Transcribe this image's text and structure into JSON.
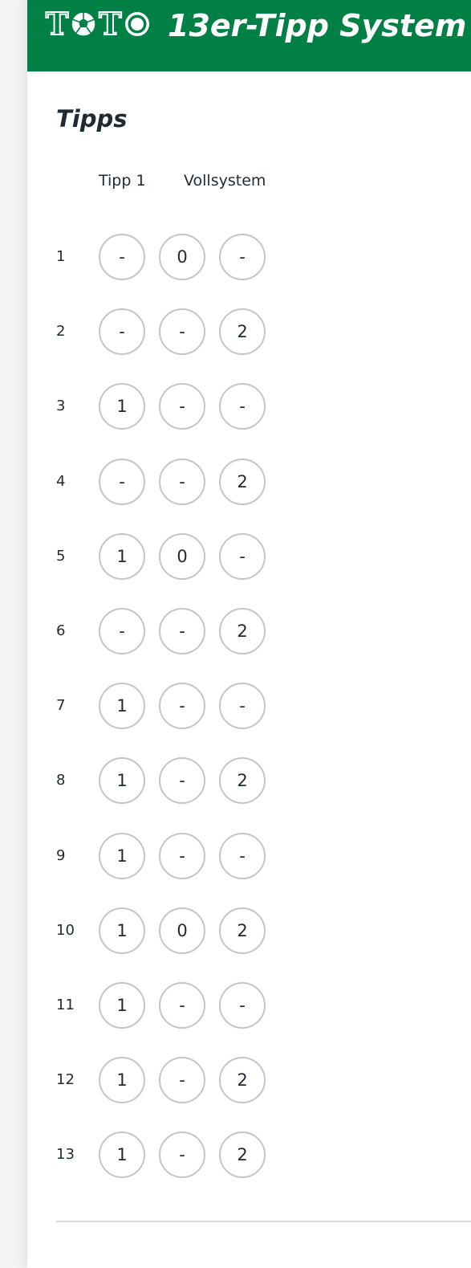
{
  "header": {
    "logo_text": "TOTO",
    "title": "13er-Tipp System"
  },
  "section": {
    "title": "Tipps",
    "columns": [
      "Tipp 1",
      "Vollsystem"
    ]
  },
  "rows": [
    {
      "number": "1",
      "picks": [
        "-",
        "0",
        "-"
      ]
    },
    {
      "number": "2",
      "picks": [
        "-",
        "-",
        "2"
      ]
    },
    {
      "number": "3",
      "picks": [
        "1",
        "-",
        "-"
      ]
    },
    {
      "number": "4",
      "picks": [
        "-",
        "-",
        "2"
      ]
    },
    {
      "number": "5",
      "picks": [
        "1",
        "0",
        "-"
      ]
    },
    {
      "number": "6",
      "picks": [
        "-",
        "-",
        "2"
      ]
    },
    {
      "number": "7",
      "picks": [
        "1",
        "-",
        "-"
      ]
    },
    {
      "number": "8",
      "picks": [
        "1",
        "-",
        "2"
      ]
    },
    {
      "number": "9",
      "picks": [
        "1",
        "-",
        "-"
      ]
    },
    {
      "number": "10",
      "picks": [
        "1",
        "0",
        "2"
      ]
    },
    {
      "number": "11",
      "picks": [
        "1",
        "-",
        "-"
      ]
    },
    {
      "number": "12",
      "picks": [
        "1",
        "-",
        "2"
      ]
    },
    {
      "number": "13",
      "picks": [
        "1",
        "-",
        "2"
      ]
    }
  ],
  "colors": {
    "brand_green": "#008044",
    "text": "#1f2a33",
    "circle_border": "#c5c5c5"
  }
}
